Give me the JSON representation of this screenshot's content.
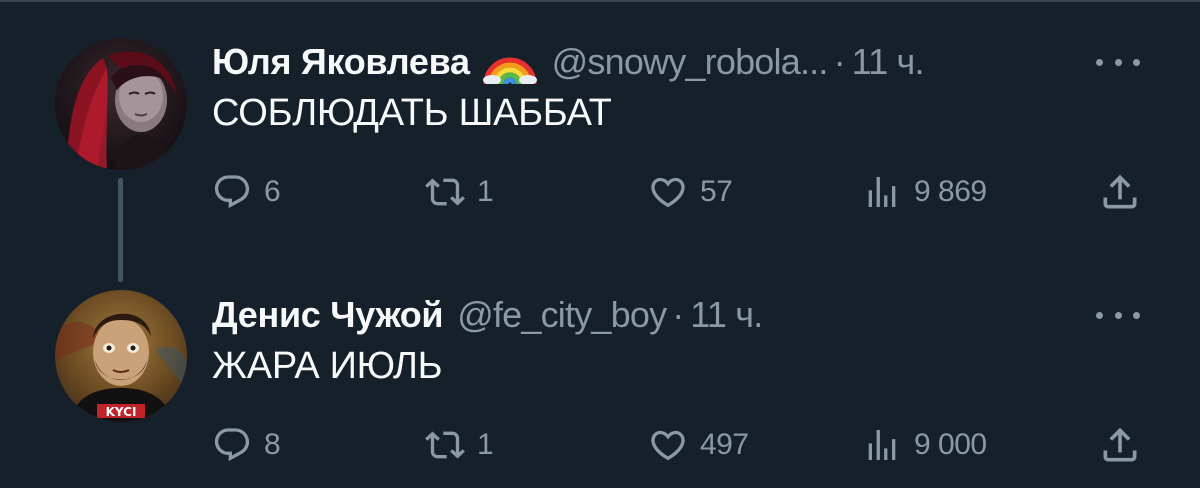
{
  "tweets": [
    {
      "author": {
        "name": "Юля Яковлева",
        "badge_emoji": "🌈",
        "handle": "@snowy_robola...",
        "avatar": "avatar-photo-red-hair"
      },
      "separator": "·",
      "time": "11 ч.",
      "text": "СОБЛЮДАТЬ ШАББАТ",
      "stats": {
        "replies": "6",
        "retweets": "1",
        "likes": "57",
        "views": "9 869"
      }
    },
    {
      "author": {
        "name": "Денис Чужой",
        "handle": "@fe_city_boy",
        "avatar": "avatar-cartoon-bearded-man",
        "avatar_shirt_text": "KYCI"
      },
      "separator": "·",
      "time": "11 ч.",
      "text": "ЖАРА ИЮЛЬ",
      "stats": {
        "replies": "8",
        "retweets": "1",
        "likes": "497",
        "views": "9 000"
      }
    }
  ],
  "icons": [
    "reply-icon",
    "retweet-icon",
    "like-icon",
    "views-icon",
    "share-icon",
    "more-icon"
  ],
  "colors": {
    "background": "#15202b",
    "primary_text": "#f7f9f9",
    "secondary_text": "#8b98a5",
    "thread_line": "#425361"
  }
}
